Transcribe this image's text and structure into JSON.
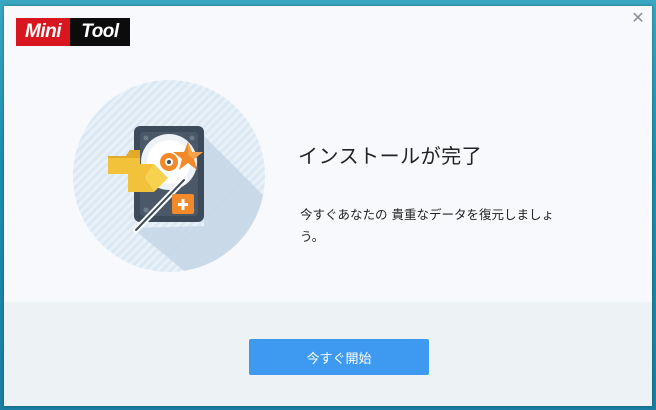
{
  "logo": {
    "part1": "Mini",
    "part2": "Tool"
  },
  "window": {
    "close_glyph": "✕"
  },
  "content": {
    "title": "インストールが完了",
    "description": "今すぐあなたの 貴重なデータを復元しましょう。"
  },
  "footer": {
    "start_button_label": "今すぐ開始"
  },
  "colors": {
    "accent": "#3d9af0",
    "logo_red": "#d7161f",
    "circle_bg": "#e3eef7",
    "folder": "#f2c33a",
    "star": "#f28a2a"
  },
  "icons": {
    "close": "close-icon",
    "illustration": "hard-drive-recovery-icon"
  }
}
